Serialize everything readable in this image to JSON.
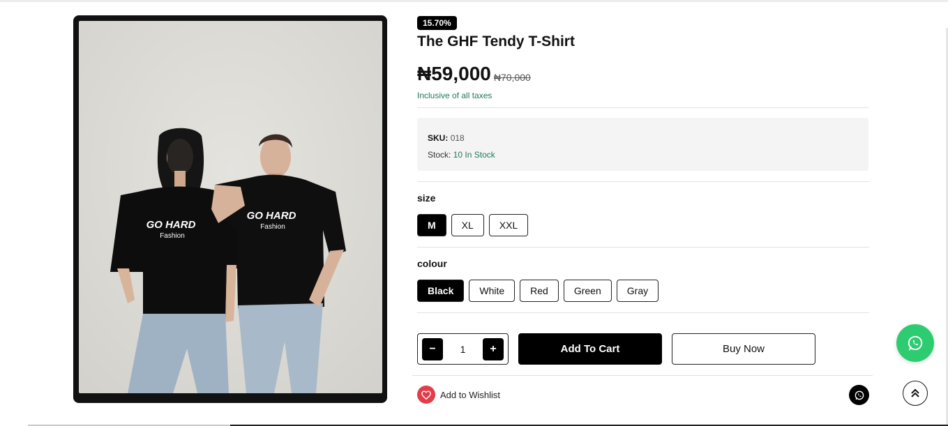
{
  "product": {
    "discount_badge": "15.70%",
    "title": "The GHF Tendy T-Shirt",
    "current_price": "₦59,000",
    "old_price": "₦70,000",
    "tax_note": "Inclusive of all taxes",
    "image_alt": "Two models wearing black GO HARD Fashion t-shirts",
    "shirt_print_main": "GO HARD",
    "shirt_print_sub": "Fashion"
  },
  "meta": {
    "sku_label": "SKU:",
    "sku_value": "018",
    "stock_label": "Stock:",
    "stock_value": "10 In Stock"
  },
  "size": {
    "label": "size",
    "options": [
      "M",
      "XL",
      "XXL"
    ],
    "selected": "M"
  },
  "colour": {
    "label": "colour",
    "options": [
      "Black",
      "White",
      "Red",
      "Green",
      "Gray"
    ],
    "selected": "Black"
  },
  "quantity": {
    "minus": "−",
    "value": "1",
    "plus": "+"
  },
  "actions": {
    "add_to_cart": "Add To Cart",
    "buy_now": "Buy Now",
    "wishlist": "Add to Wishlist"
  },
  "colors": {
    "accent_green": "#1f7a55",
    "whatsapp_green": "#2ecc71",
    "heart_red": "#e23d4a",
    "primary_black": "#000000"
  },
  "icons": {
    "heart": "heart-icon",
    "whatsapp": "whatsapp-icon",
    "scroll_top": "double-chevron-up-icon"
  }
}
